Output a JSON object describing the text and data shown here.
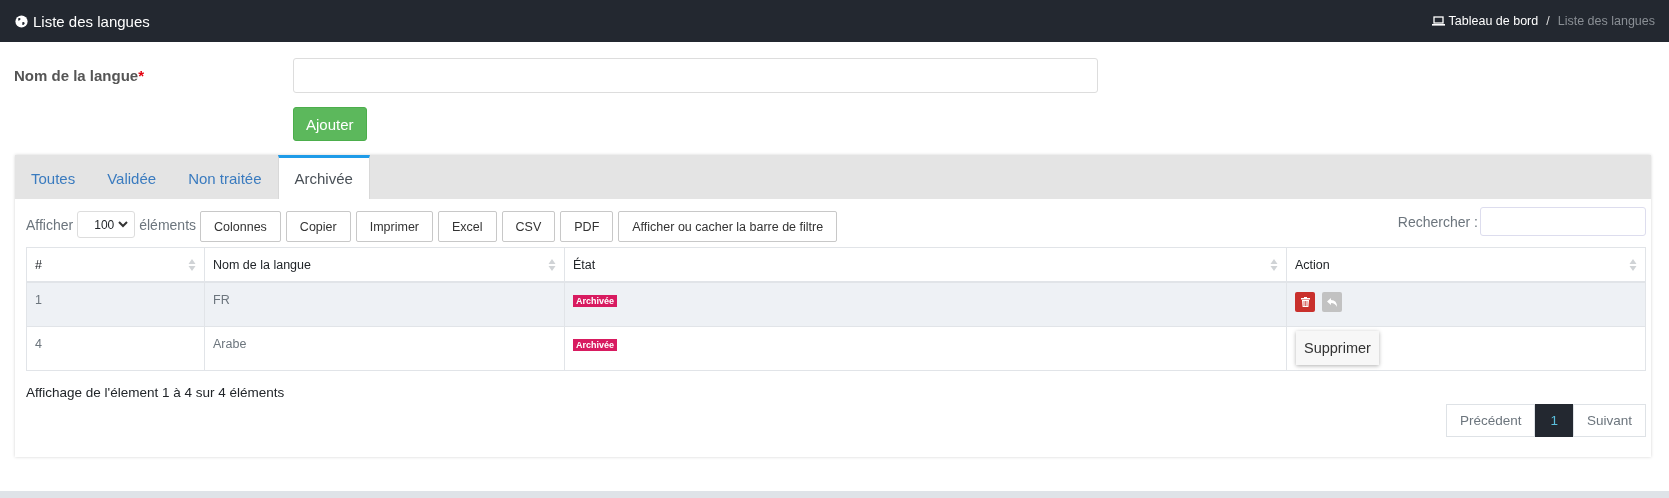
{
  "header": {
    "title": "Liste des langues",
    "breadcrumb": [
      {
        "label": "Tableau de bord",
        "kind": "link"
      },
      {
        "label": "Liste des langues",
        "kind": "current"
      }
    ],
    "separator": "/"
  },
  "form": {
    "label": "Nom de la langue",
    "required_mark": "*",
    "submit": "Ajouter"
  },
  "tabs": [
    {
      "label": "Toutes",
      "selected": false
    },
    {
      "label": "Validée",
      "selected": false
    },
    {
      "label": "Non traitée",
      "selected": false
    },
    {
      "label": "Archivée",
      "selected": true
    }
  ],
  "toolbar": {
    "length_label": "Afficher",
    "length_value": "100",
    "length_suffix": "éléments",
    "buttons": [
      "Colonnes",
      "Copier",
      "Imprimer",
      "Excel",
      "CSV",
      "PDF",
      "Afficher ou cacher la barre de filtre"
    ],
    "search_label": "Rechercher :"
  },
  "table": {
    "columns": [
      "#",
      "Nom de la langue",
      "État",
      "Action"
    ],
    "rows": [
      {
        "id": "1",
        "name": "FR",
        "state": "Archivée",
        "hovered": true,
        "actions": [
          {
            "kind": "delete",
            "disabled": false
          },
          {
            "kind": "restore",
            "disabled": true
          }
        ]
      },
      {
        "id": "4",
        "name": "Arabe",
        "state": "Archivée",
        "hovered": false,
        "actions": []
      }
    ]
  },
  "tooltip": {
    "text": "Supprimer"
  },
  "info": "Affichage de l'élement 1 à 4 sur 4 éléments",
  "pagination": {
    "previous": "Précédent",
    "pages": [
      {
        "label": "1",
        "selected": true
      }
    ],
    "next": "Suivant"
  }
}
